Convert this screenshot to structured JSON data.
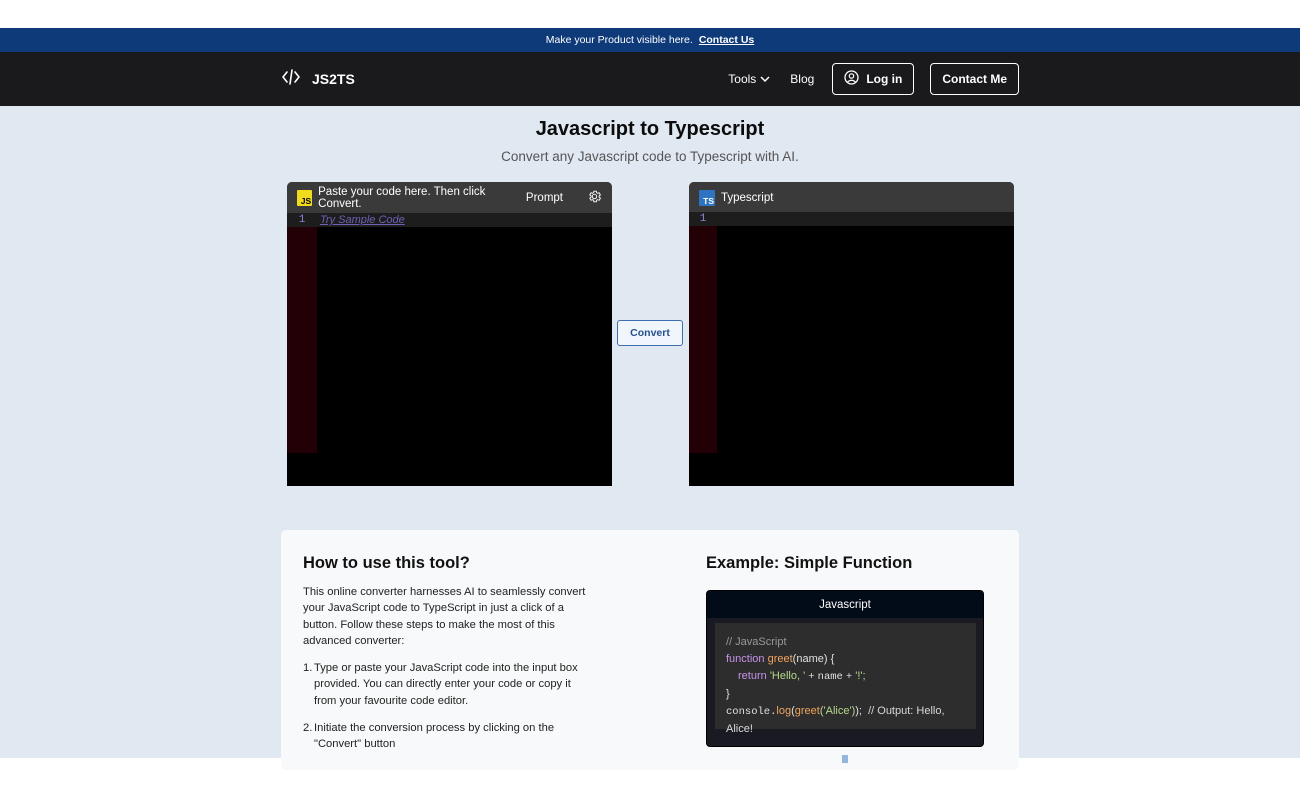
{
  "banner": {
    "text": "Make your Product visible here.",
    "link": "Contact Us"
  },
  "nav": {
    "brand": "JS2TS",
    "links": {
      "tools": "Tools",
      "blog": "Blog"
    },
    "login_label": "Log in",
    "contact_label": "Contact Me"
  },
  "hero": {
    "title": "Javascript to Typescript",
    "subtitle": "Convert any Javascript code to Typescript with AI."
  },
  "input_editor": {
    "badge": "JS",
    "hint": "Paste your code here. Then click Convert.",
    "prompt_label": "Prompt",
    "line_number": "1",
    "sample_link": "Try Sample Code"
  },
  "convert_label": "Convert",
  "output_editor": {
    "badge": "TS",
    "title": "Typescript",
    "line_number": "1"
  },
  "how_to": {
    "title": "How to use this tool?",
    "intro": "This online converter harnesses AI to seamlessly convert your JavaScript code to TypeScript in just a click of a button. Follow these steps to make the most of this advanced converter:",
    "steps": [
      {
        "num": "1.",
        "text": "Type or paste your JavaScript code into the input box provided. You can directly enter your code or copy it from your favourite code editor."
      },
      {
        "num": "2.",
        "text": "Initiate the conversion process by clicking on the \"Convert\" button"
      }
    ]
  },
  "example": {
    "title": "Example: Simple Function",
    "card_title": "Javascript",
    "code": {
      "comment": "// JavaScript",
      "kw_function": "function",
      "fn_name": "greet",
      "params": "(name)  {",
      "kw_return": "return",
      "str_hello": "'Hello, '",
      "plus1": "+",
      "var_name": "name",
      "plus2": "+",
      "str_bang": "'!';",
      "close_brace": "}",
      "console": "console.",
      "log": "log",
      "open_paren": "(",
      "call_fn": "greet",
      "call_arg": "('Alice')",
      "call_close": ");",
      "output_comment": "// Output: Hello, Alice!"
    }
  }
}
